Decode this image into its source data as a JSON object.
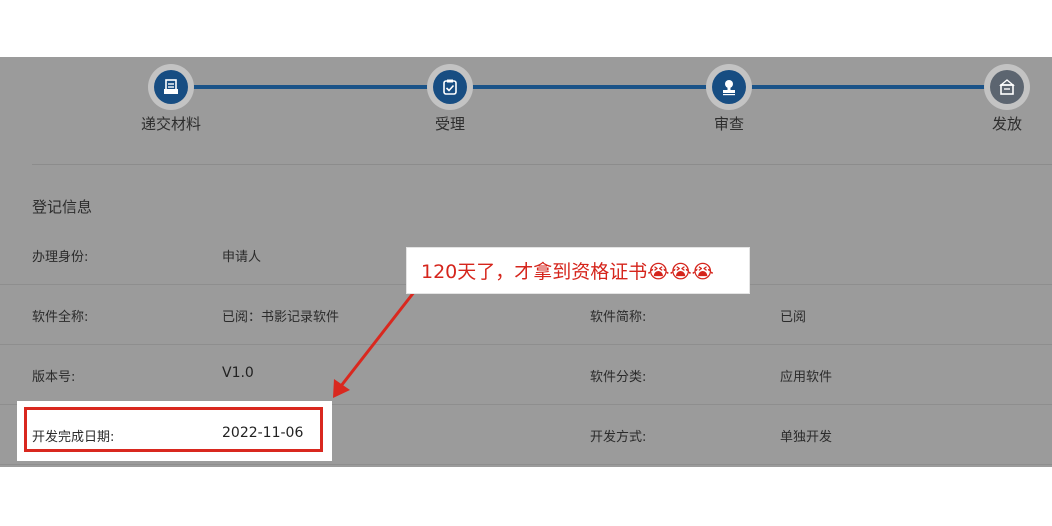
{
  "steps": [
    {
      "label": "递交材料",
      "icon": "document-icon"
    },
    {
      "label": "受理",
      "icon": "clipboard-check-icon"
    },
    {
      "label": "审查",
      "icon": "stamp-icon"
    },
    {
      "label": "发放",
      "icon": "inbox-icon"
    }
  ],
  "section": {
    "title": "登记信息"
  },
  "fields": {
    "identity": {
      "label": "办理身份:",
      "value": "申请人"
    },
    "full_name": {
      "label": "软件全称:",
      "value": "已阅：书影记录软件"
    },
    "short_name": {
      "label": "软件简称:",
      "value": "已阅"
    },
    "version": {
      "label": "版本号:",
      "value": "V1.0"
    },
    "category": {
      "label": "软件分类:",
      "value": "应用软件"
    },
    "dev_date": {
      "label": "开发完成日期:",
      "value": "2022-11-06"
    },
    "dev_mode": {
      "label": "开发方式:",
      "value": "单独开发"
    }
  },
  "callout": {
    "text": "120天了，才拿到资格证书😭😭😭"
  },
  "colors": {
    "accent": "#174d82",
    "annotation": "#d9281f"
  }
}
